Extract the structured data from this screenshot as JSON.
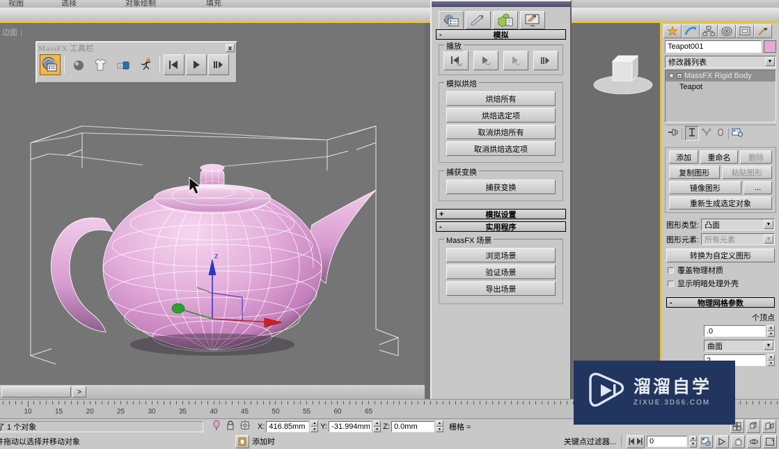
{
  "app": {
    "menu_items": [
      "视图",
      "选择",
      "对象绘制",
      "填充"
    ],
    "viewport_label": "边面",
    "viewport_label_sep": "|"
  },
  "massfx_toolbar": {
    "title": "MassFX 工具栏",
    "close_label": "x",
    "buttons": [
      {
        "name": "massfx-tools-icon",
        "title": "MassFX 工具"
      },
      {
        "name": "rigid-body-icon",
        "title": "刚体"
      },
      {
        "name": "cloth-icon",
        "title": "mCloth"
      },
      {
        "name": "constraint-icon",
        "title": "约束"
      },
      {
        "name": "ragdoll-icon",
        "title": "布娃娃"
      },
      {
        "name": "reset-simulation-icon",
        "title": "重置模拟"
      },
      {
        "name": "start-simulation-icon",
        "title": "开始模拟"
      },
      {
        "name": "step-simulation-icon",
        "title": "逐帧模拟"
      }
    ]
  },
  "massfx_dialog": {
    "tabs": [
      {
        "name": "world-tab",
        "label": "世界"
      },
      {
        "name": "tools-tab",
        "label": "工具"
      },
      {
        "name": "multi-object-tab",
        "label": "多对象编辑器"
      },
      {
        "name": "display-tab",
        "label": "显示选项"
      }
    ],
    "rollups": [
      {
        "name": "simulation-rollup",
        "sign": "-",
        "title": "模拟",
        "groups": [
          {
            "name": "playback-group",
            "label": "播放",
            "buttons": [
              {
                "name": "reset-button",
                "label": "重置模拟"
              },
              {
                "name": "start-simulation-button",
                "label": "开始模拟"
              },
              {
                "name": "start-without-animation-button",
                "label": "开始但不生成动画"
              },
              {
                "name": "step-simulation-button",
                "label": "逐帧模拟"
              }
            ]
          },
          {
            "name": "simulation-baking-group",
            "label": "模拟烘焙",
            "buttons": [
              {
                "name": "bake-all-button",
                "label": "烘焙所有"
              },
              {
                "name": "bake-selected-button",
                "label": "烘焙选定项"
              },
              {
                "name": "unbake-all-button",
                "label": "取消烘焙所有"
              },
              {
                "name": "unbake-selected-button",
                "label": "取消烘焙选定项"
              }
            ]
          },
          {
            "name": "capture-transform-group",
            "label": "捕获变换",
            "buttons": [
              {
                "name": "capture-transform-button",
                "label": "捕获变换"
              }
            ]
          }
        ]
      },
      {
        "name": "simulation-settings-rollup",
        "sign": "+",
        "title": "模拟设置",
        "groups": []
      },
      {
        "name": "utilities-rollup",
        "sign": "-",
        "title": "实用程序",
        "groups": [
          {
            "name": "massfx-scene-group",
            "label": "MassFX 场景",
            "buttons": [
              {
                "name": "explore-scene-button",
                "label": "浏览场景"
              },
              {
                "name": "validate-scene-button",
                "label": "验证场景"
              },
              {
                "name": "export-scene-button",
                "label": "导出场景"
              }
            ]
          }
        ]
      }
    ]
  },
  "command_panel": {
    "tabs": [
      {
        "name": "create-tab",
        "label": "创建"
      },
      {
        "name": "modify-tab",
        "label": "修改"
      },
      {
        "name": "hierarchy-tab",
        "label": "层次"
      },
      {
        "name": "motion-tab",
        "label": "运动"
      },
      {
        "name": "display-tab",
        "label": "显示"
      },
      {
        "name": "utilities-tab",
        "label": "实用程序"
      }
    ],
    "object_name": "Teapot001",
    "color_swatch": "#e3a8d6",
    "modifier_list_label": "修改器列表",
    "stack": [
      {
        "name": "massfx-rigid-body-entry",
        "label": "MassFX Rigid Body",
        "selected": true
      },
      {
        "name": "teapot-base-entry",
        "label": "Teapot",
        "selected": false
      }
    ],
    "stack_tools": [
      {
        "name": "pin-stack-icon"
      },
      {
        "name": "show-end-result-icon"
      },
      {
        "name": "make-unique-icon"
      },
      {
        "name": "remove-modifier-icon"
      },
      {
        "name": "configure-modifier-sets-icon"
      }
    ],
    "shape_buttons": [
      {
        "name": "add-button",
        "label": "添加",
        "disabled": false
      },
      {
        "name": "rename-button",
        "label": "重命名",
        "disabled": false
      },
      {
        "name": "delete-button",
        "label": "删除",
        "disabled": true
      },
      {
        "name": "copy-shape-button",
        "label": "复制图形",
        "disabled": false
      },
      {
        "name": "paste-shape-button",
        "label": "粘贴图形",
        "disabled": true
      },
      {
        "name": "mirror-shape-button",
        "label": "镜像图形",
        "disabled": false
      },
      {
        "name": "more-button",
        "label": "...",
        "disabled": false
      },
      {
        "name": "regenerate-selected-button",
        "label": "重新生成选定对象",
        "disabled": false
      }
    ],
    "shape_type_label": "图形类型:",
    "shape_type_value": "凸面",
    "shape_element_label": "图形元素:",
    "shape_element_value": "所有元素",
    "convert_button_label": "转换为自定义图形",
    "checkboxes": [
      {
        "name": "override-physical-material-checkbox",
        "label": "覆盖物理材质",
        "checked": false
      },
      {
        "name": "display-shaded-hull-checkbox",
        "label": "显示明暗处理外壳",
        "checked": false
      }
    ],
    "physical_mesh_rollup": {
      "sign": "-",
      "title": "物理网格参数"
    },
    "vertex_label": "个顶点",
    "vertex_value": ".0",
    "mesh_combo_value": "曲面",
    "mesh_value2": "2"
  },
  "timeline": {
    "tick_labels": [
      "10",
      "15",
      "20",
      "25",
      "30",
      "35",
      "40",
      "45",
      "50",
      "55",
      "60",
      "65"
    ],
    "next_key_label": ">",
    "frame_field_value": "0",
    "key_filter_label": "关键点过滤器..."
  },
  "status": {
    "selection_text": "了 1 个对象",
    "prompt_text": "并拖动以选择并移动对象",
    "x_label": "X:",
    "x_value": "416.85mm",
    "y_label": "Y:",
    "y_value": "-31.994mm",
    "z_label": "Z:",
    "z_value": "0.0mm",
    "grid_label": "栅格 =",
    "add_time_tag_label": "添加时",
    "icons": [
      {
        "name": "selection-lock-icon"
      },
      {
        "name": "lock-selection-icon"
      },
      {
        "name": "absolute-relative-mode-icon"
      }
    ]
  },
  "watermark": {
    "title": "溜溜自学",
    "subtitle": "ZIXUE.3D66.COM",
    "play_icon": "play-triangle-icon",
    "bg_color": "#22355e"
  },
  "colors": {
    "gold_accent": "#e8c33a",
    "panel_bg": "#c8c8c8",
    "viewport_bg": "#757575",
    "teapot_fill": "#e0a8d4"
  }
}
